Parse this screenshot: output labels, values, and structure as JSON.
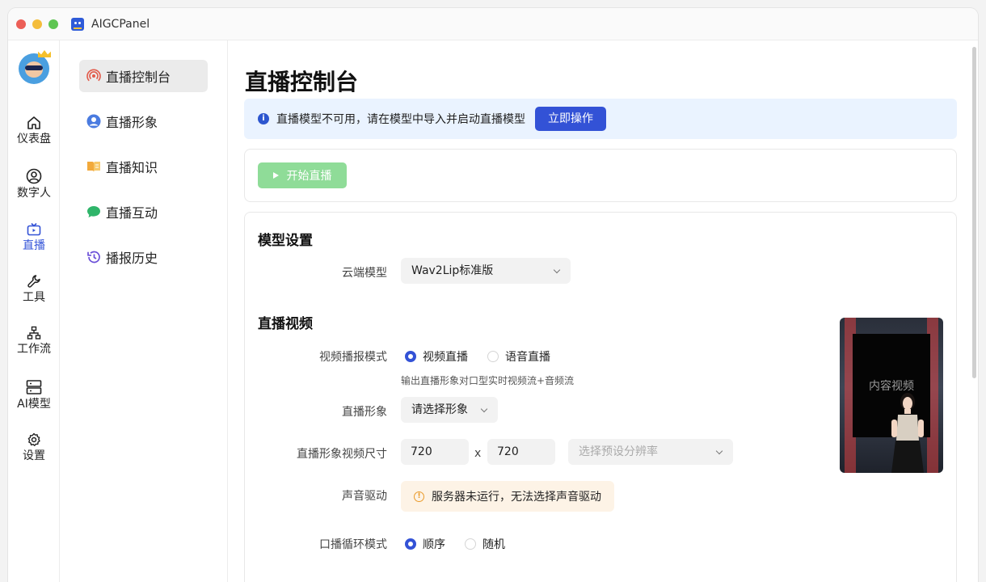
{
  "window": {
    "title": "AIGCPanel",
    "colors": {
      "close": "#ec5f57",
      "minimize": "#f4bd3b",
      "maximize": "#5ec552",
      "accent": "#3352d6"
    }
  },
  "rail": {
    "items": [
      {
        "label": "仪表盘",
        "icon": "home-icon"
      },
      {
        "label": "数字人",
        "icon": "user-circle-icon"
      },
      {
        "label": "直播",
        "icon": "tv-icon",
        "active": true
      },
      {
        "label": "工具",
        "icon": "wrench-icon"
      },
      {
        "label": "工作流",
        "icon": "workflow-icon"
      },
      {
        "label": "AI模型",
        "icon": "server-icon"
      },
      {
        "label": "设置",
        "icon": "gear-icon"
      }
    ]
  },
  "subnav": {
    "items": [
      {
        "label": "直播控制台",
        "icon": "broadcast-icon",
        "active": true
      },
      {
        "label": "直播形象",
        "icon": "avatar-icon"
      },
      {
        "label": "直播知识",
        "icon": "book-icon"
      },
      {
        "label": "直播互动",
        "icon": "chat-icon"
      },
      {
        "label": "播报历史",
        "icon": "history-icon"
      }
    ]
  },
  "main": {
    "title": "直播控制台",
    "alert": {
      "text": "直播模型不可用，请在模型中导入并启动直播模型",
      "action": "立即操作"
    },
    "start_button": "开始直播",
    "model_section": {
      "title": "模型设置",
      "cloud_model_label": "云端模型",
      "cloud_model_value": "Wav2Lip标准版"
    },
    "video_section": {
      "title": "直播视频",
      "mode_label": "视频播报模式",
      "mode_options": [
        "视频直播",
        "语音直播"
      ],
      "mode_selected": 0,
      "mode_hint": "输出直播形象对口型实时视频流+音频流",
      "avatar_label": "直播形象",
      "avatar_placeholder": "请选择形象",
      "size_label": "直播形象视频尺寸",
      "width": "720",
      "height": "720",
      "times": "x",
      "preset_placeholder": "选择预设分辨率",
      "voice_label": "声音驱动",
      "voice_warning": "服务器未运行，无法选择声音驱动",
      "loop_label": "口播循环模式",
      "loop_options": [
        "顺序",
        "随机"
      ],
      "loop_selected": 0,
      "preview_text": "内容视频"
    }
  }
}
